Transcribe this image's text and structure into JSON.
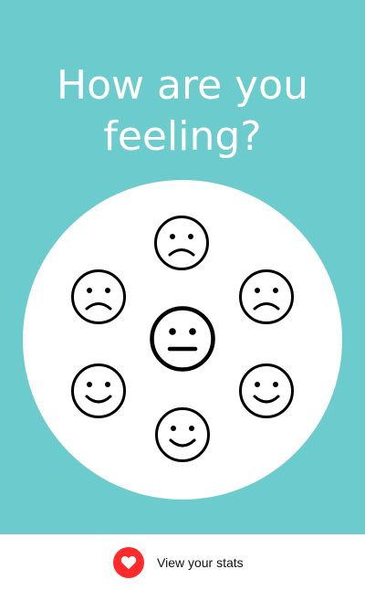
{
  "header": {
    "title_line1": "How are you",
    "title_line2": "feeling?"
  },
  "mood_picker": {
    "options": [
      {
        "mood": "sad",
        "icon": "sad-face-icon"
      },
      {
        "mood": "sad",
        "icon": "sad-face-icon"
      },
      {
        "mood": "sad",
        "icon": "sad-face-icon"
      },
      {
        "mood": "neutral",
        "icon": "neutral-face-icon"
      },
      {
        "mood": "happy",
        "icon": "happy-face-icon"
      },
      {
        "mood": "happy",
        "icon": "happy-face-icon"
      },
      {
        "mood": "happy",
        "icon": "happy-face-icon"
      }
    ]
  },
  "footer": {
    "stats_label": "View your stats",
    "stats_icon": "heart-icon"
  },
  "colors": {
    "background": "#6ccbcc",
    "disc": "#ffffff",
    "accent_red": "#ff2a2a",
    "icon_stroke": "#000000"
  }
}
